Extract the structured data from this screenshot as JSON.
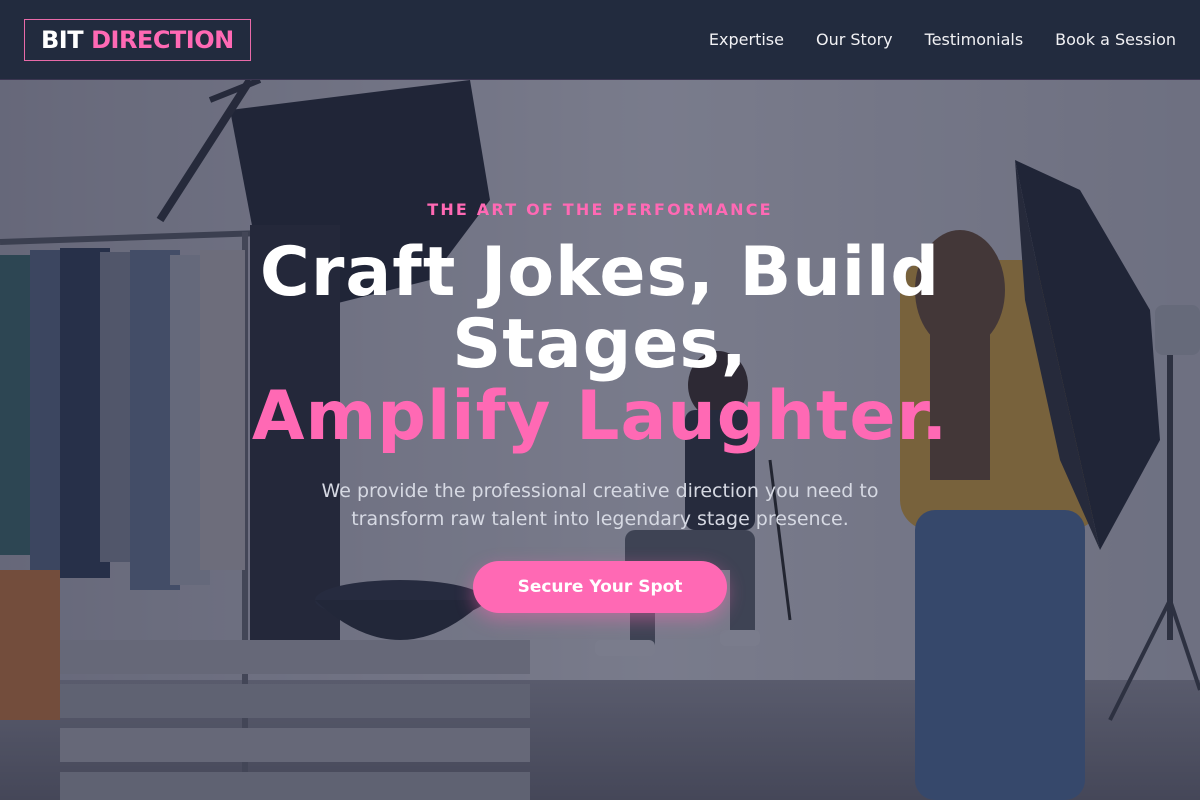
{
  "brand": {
    "part1": "BIT",
    "part2": "DIRECTION"
  },
  "nav": {
    "items": [
      {
        "label": "Expertise"
      },
      {
        "label": "Our Story"
      },
      {
        "label": "Testimonials"
      },
      {
        "label": "Book a Session"
      }
    ]
  },
  "hero": {
    "eyebrow": "THE ART OF THE PERFORMANCE",
    "headline_line1": "Craft Jokes, Build Stages,",
    "headline_line2": "Amplify Laughter.",
    "subtitle": "We provide the professional creative direction you need to transform raw talent into legendary stage presence.",
    "cta_label": "Secure Your Spot"
  },
  "colors": {
    "accent": "#ff69b4",
    "header_bg": "#222b3e",
    "overlay": "#22283e"
  }
}
